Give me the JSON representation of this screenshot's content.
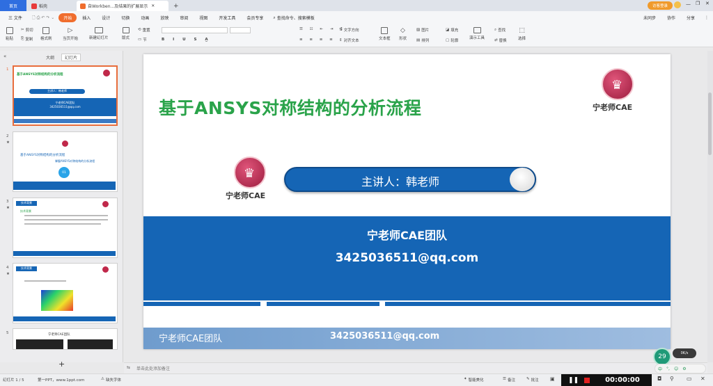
{
  "tabs": {
    "home": "首页",
    "daoke": "稻壳",
    "doc": "自Workben...及结果的扩展显示"
  },
  "account": {
    "status": "访客登录"
  },
  "menu": {
    "file": "三 文件",
    "items": [
      "开始",
      "插入",
      "设计",
      "切换",
      "动画",
      "放映",
      "审阅",
      "视图",
      "开发工具",
      "会员专享"
    ],
    "search": "查找命令、搜索模板",
    "right": [
      "未同步",
      "协作",
      "分享"
    ]
  },
  "toolbar": {
    "paste": "粘贴",
    "cut": "剪切",
    "copy": "复制",
    "format_painter": "格式刷",
    "play_from_current": "当页开始",
    "new_slide": "新建幻灯片",
    "layout": "版式",
    "section": "节",
    "reset": "重置",
    "textbox": "文本框",
    "shape": "形状",
    "arrange": "排列",
    "outline": "轮廓",
    "find": "查找",
    "replace": "替换",
    "select": "选择",
    "convert_art": "转智能图形",
    "text_direction": "文字方向",
    "align_text": "对齐文本",
    "picture": "图片",
    "fill": "填充",
    "presenter_tools": "演示工具"
  },
  "leftpanel": {
    "tab_outline": "大纲",
    "tab_slides": "幻灯片",
    "slide_numbers": [
      "1",
      "2",
      "3",
      "4",
      "5"
    ],
    "thumb1": {
      "title": "基于ANSYS对称结构的分析流程",
      "speaker": "主讲人：韩老师",
      "team": "宁老师CAE团队",
      "email": "3425036511@qq.com"
    },
    "thumb2": {
      "title": "基于ANSYS对称结构的分析流程",
      "sub": "掌握ANSYS对称结构的分析流程",
      "num": "01"
    },
    "thumb3": {
      "tag": "技术背景",
      "heading": "技术背景"
    },
    "thumb4": {
      "tag": "技术背景"
    },
    "thumb5": {
      "title": "宁老师CAE团队"
    },
    "add": "+"
  },
  "slide": {
    "title": "基于ANSYS对称结构的分析流程",
    "logo_text": "宁老师CAE",
    "speaker": "主讲人：韩老师",
    "team": "宁老师CAE团队",
    "email": "3425036511@qq.com",
    "footer_team": "宁老师CAE团队",
    "footer_email": "3425036511@qq.com"
  },
  "notes": {
    "placeholder": "单击此处添加备注"
  },
  "statusbar": {
    "slide_count": "幻灯片 1 / 5",
    "theme": "第一PPT，www.1ppt.com",
    "missing_font": "缺失字体",
    "smart_beautify": "智能美化",
    "notes": "备注",
    "comment": "批注",
    "timer": "00:00:00"
  },
  "overlay": {
    "percent": "29",
    "speed": "0K/s",
    "ime": "中"
  },
  "colors": {
    "accent_orange": "#f06d2d",
    "slide_blue": "#1565b5",
    "title_green": "#2aa34a",
    "ribbon_blue": "#1f63b5"
  }
}
